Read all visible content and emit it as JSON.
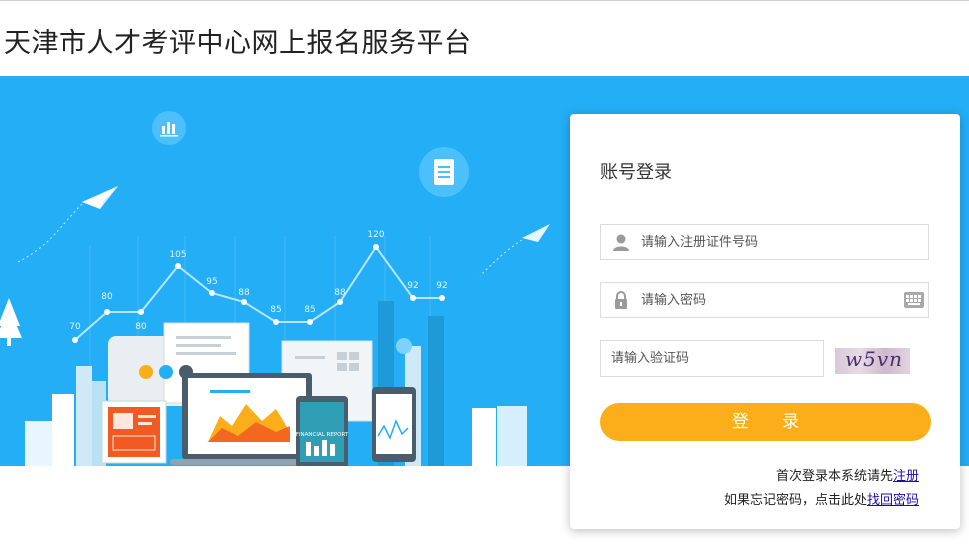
{
  "header": {
    "title": "天津市人才考评中心网上报名服务平台"
  },
  "banner": {
    "chart_labels": [
      "70",
      "80",
      "80",
      "105",
      "95",
      "88",
      "85",
      "85",
      "88",
      "120",
      "92",
      "92"
    ],
    "report_text": "FINANCIAL REPORT"
  },
  "login": {
    "title": "账号登录",
    "id_placeholder": "请输入注册证件号码",
    "password_placeholder": "请输入密码",
    "captcha_placeholder": "请输入验证码",
    "captcha_text": "w5vn",
    "submit_label": "登 录",
    "register_prompt": "首次登录本系统请先",
    "register_link": "注册",
    "forgot_prompt": "如果忘记密码，点击此处",
    "forgot_link": "找回密码"
  },
  "colors": {
    "banner_blue": "#23aef6",
    "button_orange": "#fbae1a",
    "link_blue": "#1a0dab"
  },
  "icons": [
    "user-icon",
    "lock-icon",
    "keyboard-icon",
    "chart-icon",
    "document-icon",
    "paper-plane-icon",
    "tree-icon"
  ]
}
